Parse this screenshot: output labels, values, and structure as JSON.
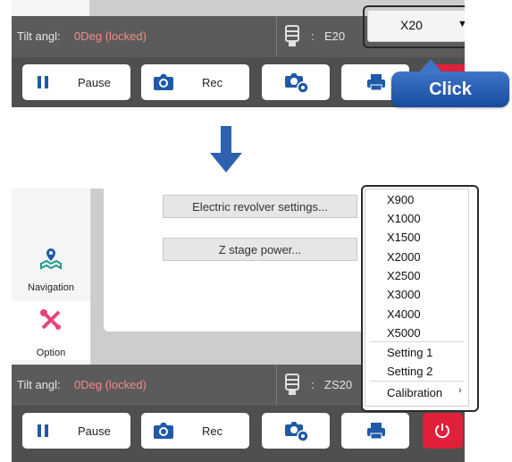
{
  "top": {
    "status": {
      "tilt_label": "Tilt angl:",
      "tilt_value": "0Deg (locked)",
      "colon": ":",
      "lens_value": "E20"
    },
    "dropdown": {
      "value": "X20",
      "arrow": "▼"
    },
    "toolbar": {
      "pause_label": "Pause",
      "rec_label": "Rec"
    },
    "callout": "Click"
  },
  "bottom": {
    "sidebar": {
      "navigation_label": "Navigation",
      "option_label": "Option"
    },
    "settings": {
      "revolver_label": "Electric revolver settings...",
      "zstage_label": "Z stage power..."
    },
    "status": {
      "tilt_label": "Tilt angl:",
      "tilt_value": "0Deg (locked)",
      "colon": ":",
      "lens_value": "ZS20"
    },
    "toolbar": {
      "pause_label": "Pause",
      "rec_label": "Rec"
    },
    "dropdown_options": [
      "X900",
      "X1000",
      "X1500",
      "X2000",
      "X2500",
      "X3000",
      "X4000",
      "X5000",
      "Setting 1",
      "Setting 2",
      "Calibration"
    ],
    "submenu_arrow": "›"
  },
  "colors": {
    "status_bar": "#5b5b5b",
    "toolbar": "#4f4f4f",
    "locked_text": "#f08a8a",
    "accent_blue": "#2e62b0",
    "power_red": "#e0203a",
    "option_pink": "#e6457a",
    "nav_teal": "#1a9a8a"
  },
  "icons": [
    "pause-icon",
    "camera-icon",
    "camera-settings-icon",
    "printer-icon",
    "power-icon",
    "nosepiece-icon",
    "navigation-map-icon",
    "tools-icon",
    "down-arrow"
  ]
}
